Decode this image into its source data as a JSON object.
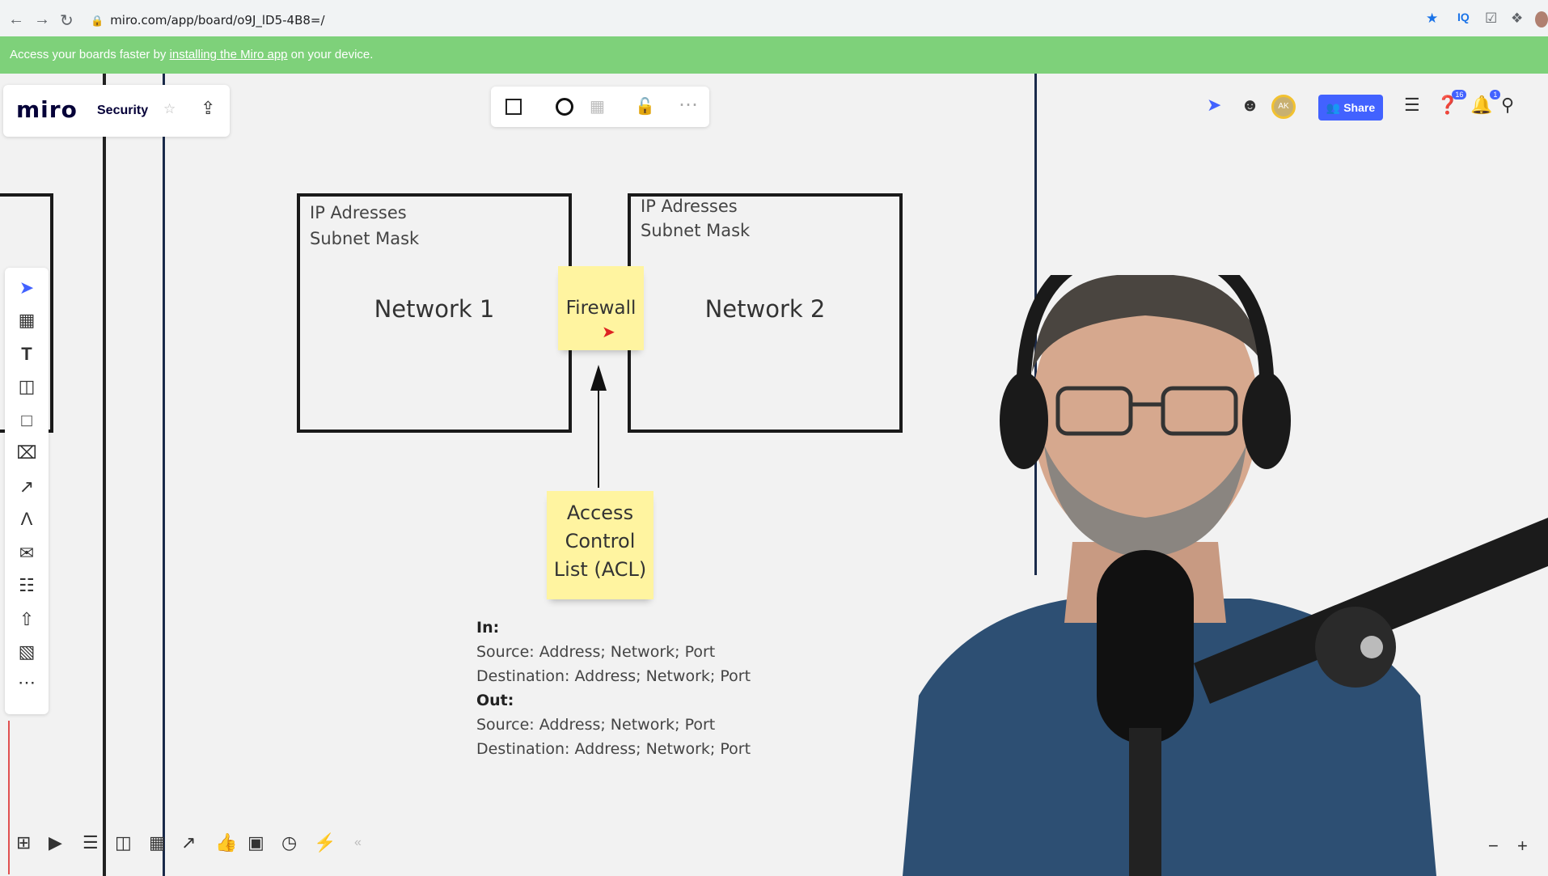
{
  "browser": {
    "url": "miro.com/app/board/o9J_lD5-4B8=/"
  },
  "banner": {
    "text_before": "Access your boards faster by ",
    "link": "installing the Miro app",
    "text_after": " on your device."
  },
  "header": {
    "logo": "miro",
    "board_name": "Security",
    "share_label": "Share",
    "avatar_initials": "AK",
    "help_badge": "16",
    "notif_badge": "1"
  },
  "diagram": {
    "network1": {
      "line1": "IP Adresses",
      "line2": "Subnet Mask",
      "title": "Network 1"
    },
    "network2": {
      "line1": "IP Adresses",
      "line2": "Subnet Mask",
      "title": "Network 2"
    },
    "firewall": "Firewall",
    "acl": {
      "line1": "Access",
      "line2": "Control",
      "line3": "List (ACL)"
    },
    "rules": {
      "in_label": "In:",
      "in_source": "Source: Address; Network; Port",
      "in_dest": "Destination: Address; Network; Port",
      "out_label": "Out:",
      "out_source": "Source: Address; Network; Port",
      "out_dest": "Destination: Address; Network; Port"
    }
  },
  "colors": {
    "banner": "#7ed17a",
    "share": "#4262ff",
    "sticky": "#fff4a0"
  },
  "icons": {
    "toolbar_left": [
      "cursor-icon",
      "template-icon",
      "text-icon",
      "sticky-note-icon",
      "shape-icon",
      "frame-x-icon",
      "pen-line-icon",
      "pen-icon",
      "comment-icon",
      "frame-icon",
      "upload-icon",
      "kanban-icon",
      "more-icon"
    ]
  }
}
